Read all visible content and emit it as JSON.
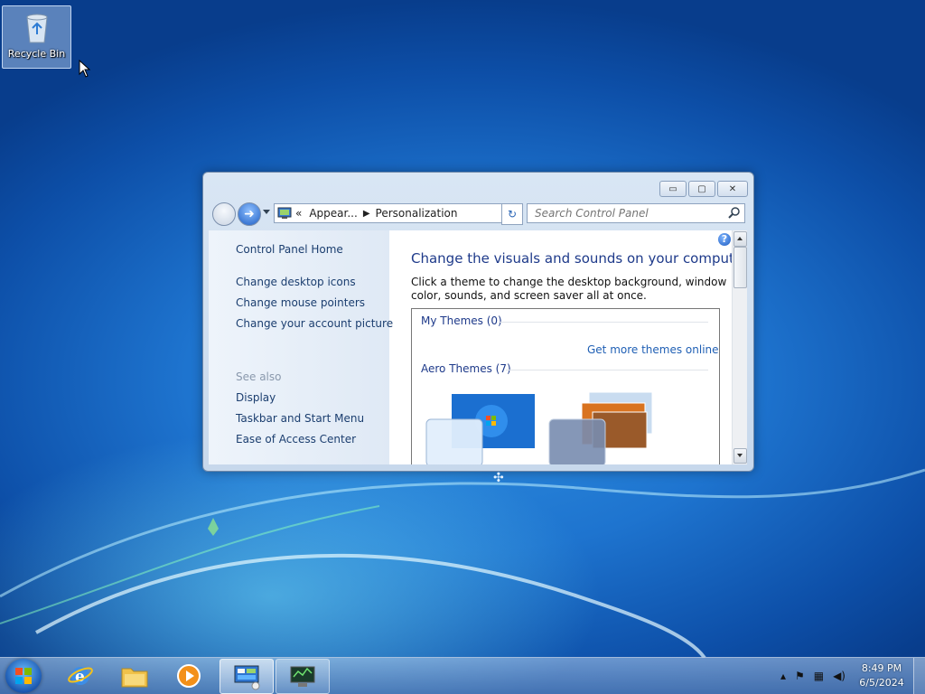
{
  "desktop": {
    "recycle_bin_label": "Recycle Bin"
  },
  "window": {
    "controls": {
      "minimize": "▭",
      "maximize": "▢",
      "close": "✕"
    },
    "address": {
      "prefix": "«",
      "crumb_1": "Appear...",
      "crumb_2": "Personalization"
    },
    "search": {
      "placeholder": "Search Control Panel"
    },
    "left_pane": {
      "home": "Control Panel Home",
      "links": [
        "Change desktop icons",
        "Change mouse pointers",
        "Change your account picture"
      ],
      "see_also_label": "See also",
      "see_also": [
        "Display",
        "Taskbar and Start Menu",
        "Ease of Access Center"
      ]
    },
    "main": {
      "title": "Change the visuals and sounds on your computer",
      "description": "Click a theme to change the desktop background, window color, sounds, and screen saver all at once.",
      "my_themes": "My Themes (0)",
      "more_themes_link": "Get more themes online",
      "aero_themes": "Aero Themes (7)"
    }
  },
  "taskbar": {
    "clock_time": "8:49 PM",
    "clock_date": "6/5/2024"
  },
  "colors": {
    "accent": "#1e3a8a",
    "link": "#1f5fb4"
  }
}
